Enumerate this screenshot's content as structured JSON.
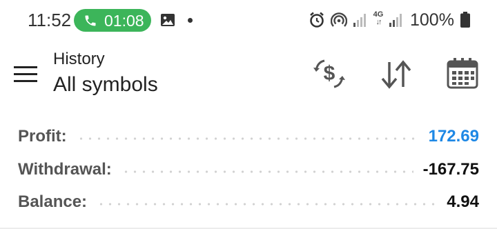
{
  "status_bar": {
    "time": "11:52",
    "call_timer": "01:08",
    "battery_percent": "100%",
    "network_type": "4G",
    "icons": [
      "phone-icon",
      "gallery-icon",
      "notification-dot-icon",
      "alarm-icon",
      "hotspot-icon",
      "signal-icon",
      "signal-icon",
      "battery-icon"
    ],
    "call_color": "#3cb55a"
  },
  "header": {
    "subtitle": "History",
    "title": "All symbols",
    "actions": [
      "currency-exchange-icon",
      "sort-icon",
      "calendar-icon"
    ]
  },
  "summary": {
    "profit": {
      "label": "Profit:",
      "value": "172.69",
      "color": "#1e88e5"
    },
    "withdrawal": {
      "label": "Withdrawal:",
      "value": "-167.75"
    },
    "balance": {
      "label": "Balance:",
      "value": "4.94"
    }
  }
}
